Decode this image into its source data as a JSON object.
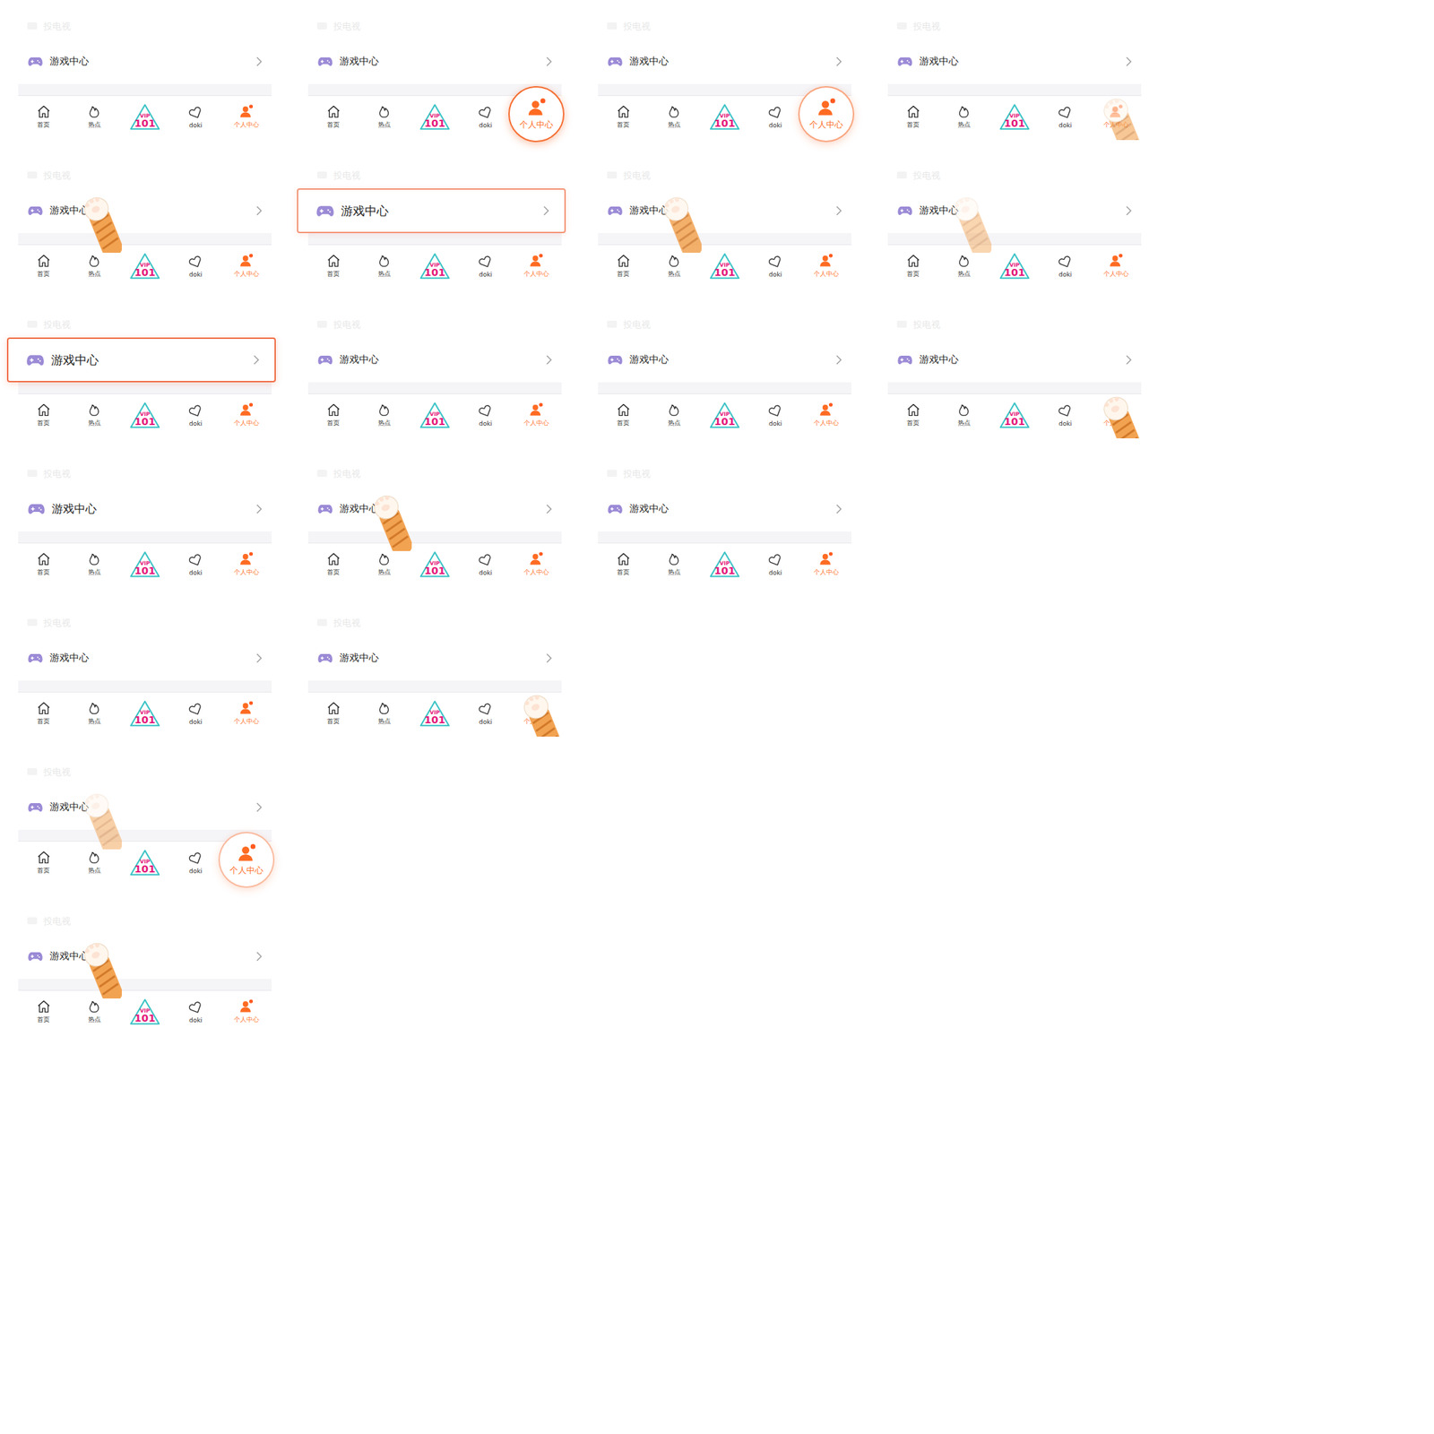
{
  "screen": {
    "cast_label": "投电视",
    "game_label": "游戏中心",
    "tabs": [
      {
        "kind": "home",
        "label": "首页",
        "selected": false,
        "dot": false
      },
      {
        "kind": "hot",
        "label": "热点",
        "selected": false,
        "dot": false
      },
      {
        "kind": "logo",
        "label": "101",
        "top": "VIP",
        "selected": false,
        "dot": false
      },
      {
        "kind": "doki",
        "label": "doki",
        "selected": false,
        "dot": false
      },
      {
        "kind": "me",
        "label": "个人中心",
        "selected": true,
        "dot": true
      }
    ]
  },
  "frames": [
    [
      {
        "highlight": "none",
        "glow": 0,
        "paw": "none",
        "paw_level": 0
      },
      {
        "highlight": "tab",
        "glow": 1,
        "paw": "none",
        "paw_level": 0
      },
      {
        "highlight": "tab",
        "glow": 0.5,
        "paw": "none",
        "paw_level": 0
      },
      {
        "highlight": "none",
        "glow": 0,
        "paw": "tab",
        "paw_level": 0.6
      }
    ],
    [
      {
        "highlight": "none",
        "glow": 0,
        "paw": "row",
        "paw_level": 1
      },
      {
        "highlight": "row",
        "glow": 0.55,
        "paw": "none",
        "paw_level": 0
      },
      {
        "highlight": "none",
        "glow": 0,
        "paw": "row",
        "paw_level": 0.85
      },
      {
        "highlight": "none",
        "glow": 0,
        "paw": "row",
        "paw_level": 0.45
      }
    ],
    [
      {
        "highlight": "row",
        "glow": 1,
        "paw": "none",
        "paw_level": 0
      },
      {
        "highlight": "none",
        "glow": 0,
        "paw": "none",
        "paw_level": 0
      },
      {
        "highlight": "none",
        "glow": 0,
        "paw": "none",
        "paw_level": 0
      },
      {
        "highlight": "none",
        "glow": 0,
        "paw": "tab",
        "paw_level": 1
      }
    ],
    [
      {
        "highlight": "row-grow",
        "glow": 0,
        "paw": "none",
        "paw_level": 0
      },
      {
        "highlight": "none",
        "glow": 0,
        "paw": "row",
        "paw_level": 1
      },
      {
        "highlight": "none",
        "glow": 0,
        "paw": "none",
        "paw_level": 0
      }
    ],
    [
      {
        "highlight": "none",
        "glow": 0,
        "paw": "none",
        "paw_level": 0
      },
      {
        "highlight": "none",
        "glow": 0,
        "paw": "tab",
        "paw_level": 1
      }
    ],
    [
      {
        "highlight": "tab",
        "glow": 0.3,
        "paw": "row",
        "paw_level": 0.5
      }
    ],
    [
      {
        "highlight": "none",
        "glow": 0,
        "paw": "row",
        "paw_level": 1
      }
    ]
  ]
}
